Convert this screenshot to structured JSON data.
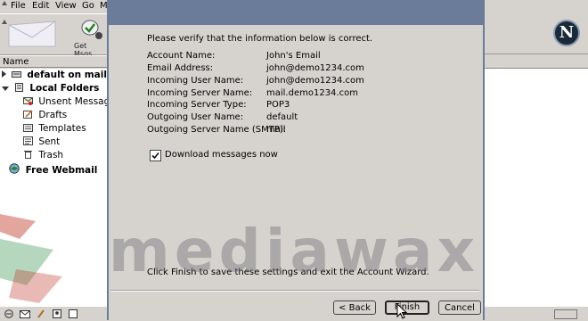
{
  "menubar": {
    "items": [
      "File",
      "Edit",
      "View",
      "Go",
      "M"
    ]
  },
  "toolbar": {
    "get_msgs_label": "Get Msgs",
    "get_msgs_icon": "get-messages-icon"
  },
  "folder_pane": {
    "header": "Name",
    "folders": [
      {
        "label": "default on mail",
        "bold": true,
        "icon": "server-icon",
        "twisty": "collapsed"
      },
      {
        "label": "Local Folders",
        "bold": true,
        "icon": "local-folders-icon",
        "twisty": "expanded"
      },
      {
        "label": "Unsent Messages",
        "bold": false,
        "icon": "unsent-icon"
      },
      {
        "label": "Drafts",
        "bold": false,
        "icon": "drafts-icon"
      },
      {
        "label": "Templates",
        "bold": false,
        "icon": "templates-icon"
      },
      {
        "label": "Sent",
        "bold": false,
        "icon": "sent-icon"
      },
      {
        "label": "Trash",
        "bold": false,
        "icon": "trash-icon"
      },
      {
        "label": "Free Webmail",
        "bold": true,
        "icon": "webmail-icon"
      }
    ]
  },
  "wizard": {
    "intro": "Please verify that the information below is correct.",
    "fields": [
      {
        "label": "Account Name:",
        "value": "John's Email"
      },
      {
        "label": "Email Address:",
        "value": "john@demo1234.com"
      },
      {
        "label": "Incoming User Name:",
        "value": "john@demo1234.com"
      },
      {
        "label": "Incoming Server Name:",
        "value": "mail.demo1234.com"
      },
      {
        "label": "Incoming Server Type:",
        "value": "POP3"
      },
      {
        "label": "Outgoing User Name:",
        "value": "default"
      },
      {
        "label": "Outgoing Server Name (SMTP):",
        "value": "mail"
      }
    ],
    "download_checkbox": {
      "label": "Download messages now",
      "checked": true
    },
    "footer": "Click Finish to save these settings and exit the Account Wizard.",
    "buttons": {
      "back": "< Back",
      "finish": "Finish",
      "cancel": "Cancel"
    }
  },
  "watermark": "mediawax",
  "colors": {
    "titlebar": "#6a7c9a",
    "chrome": "#d6d3ce",
    "watermark_red": "#c0392b"
  }
}
